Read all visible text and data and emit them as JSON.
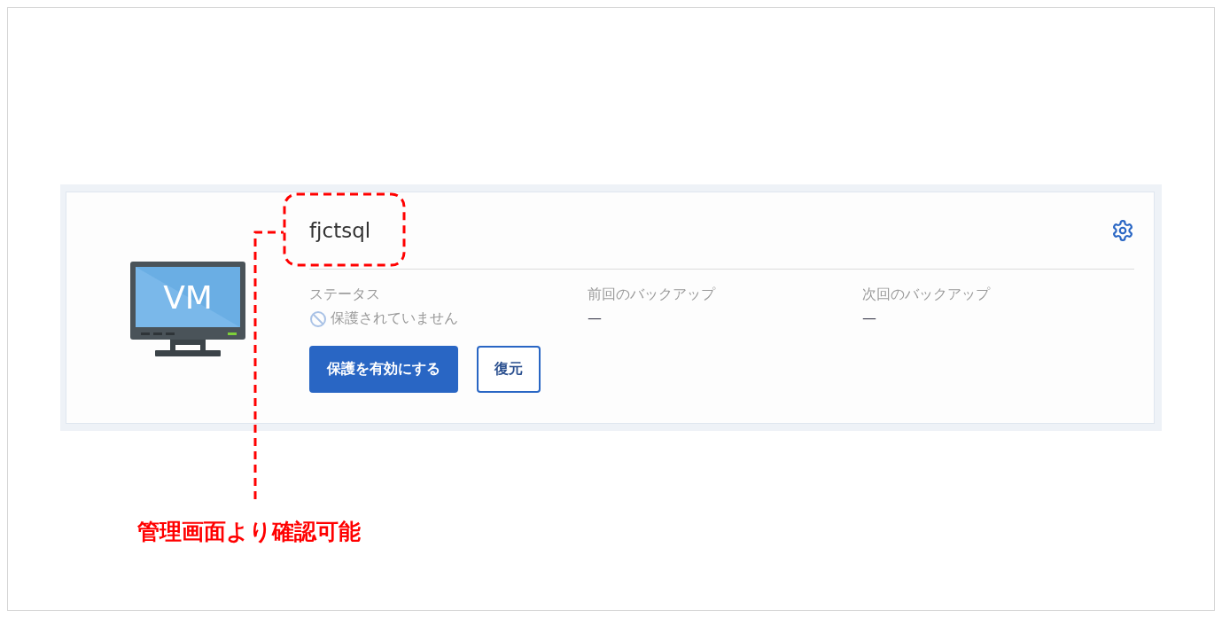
{
  "card": {
    "title": "fjctsql",
    "monitor_label": "VM",
    "fields": [
      {
        "label": "ステータス",
        "value": "保護されていません",
        "kind": "status"
      },
      {
        "label": "前回のバックアップ",
        "value": "—",
        "kind": "dash"
      },
      {
        "label": "次回のバックアップ",
        "value": "—",
        "kind": "dash"
      }
    ],
    "buttons": [
      {
        "label": "保護を有効にする",
        "kind": "primary"
      },
      {
        "label": "復元",
        "kind": "secondary"
      }
    ]
  },
  "annotation": {
    "text": "管理画面より確認可能"
  }
}
